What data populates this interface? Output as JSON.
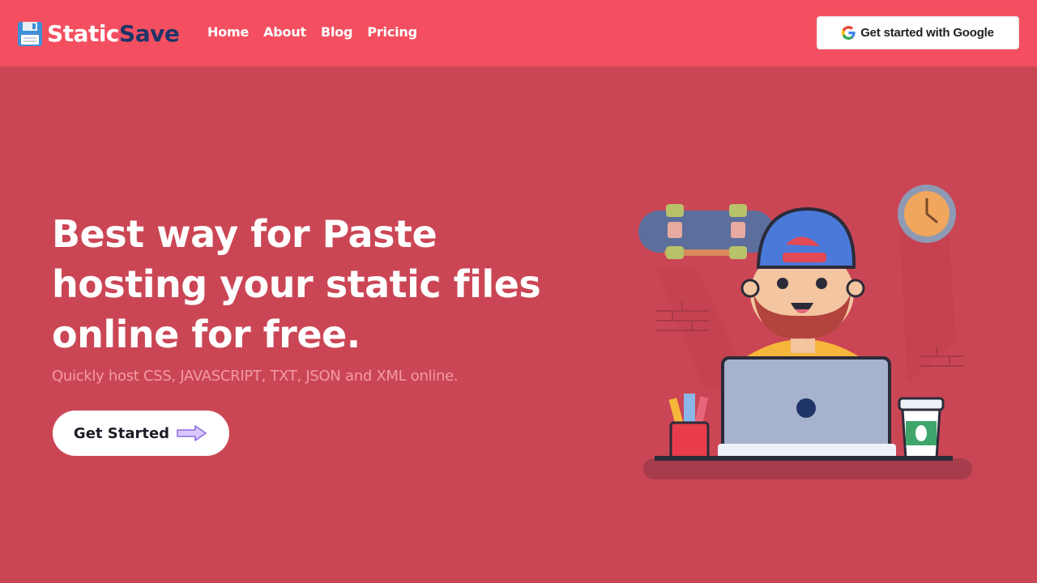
{
  "brand": {
    "name_part1": "Static",
    "name_part2": "Save",
    "icon": "floppy-disk-icon"
  },
  "nav": {
    "links": [
      "Home",
      "About",
      "Blog",
      "Pricing"
    ]
  },
  "auth": {
    "google_button_label": "Get started with Google",
    "icon": "google-g-icon"
  },
  "hero": {
    "title_lines": [
      "Best way for Paste",
      "hosting your static files",
      "online for free."
    ],
    "subtitle": "Quickly host CSS, JAVASCRIPT, TXT, JSON and XML online.",
    "cta_label": "Get Started",
    "cta_icon": "arrow-right-icon"
  },
  "colors": {
    "navbar_bg": "#f44f60",
    "page_bg": "#cb4655",
    "brand_accent": "#1f3567",
    "subtitle": "#f39aa3"
  }
}
